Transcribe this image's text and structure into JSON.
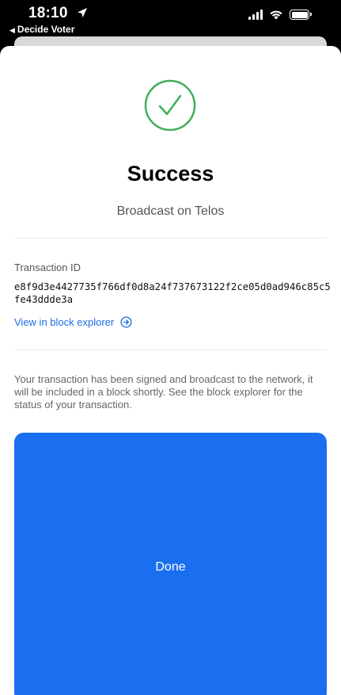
{
  "status_bar": {
    "time": "18:10",
    "back_app": "Decide Voter"
  },
  "success": {
    "title": "Success",
    "subtitle": "Broadcast on Telos",
    "icon_color": "#3fae5a"
  },
  "transaction": {
    "label": "Transaction ID",
    "id": "e8f9d3e4427735f766df0d8a24f737673122f2ce05d0ad946c85c5fe43ddde3a",
    "explorer_link": "View in block explorer"
  },
  "description": "Your transaction has been signed and broadcast to the network, it will be included in a block shortly. See the block explorer for the status of your transaction.",
  "done_button": {
    "label": "Done",
    "color": "#1a6ff0"
  },
  "accent_color": "#1a6fe6"
}
